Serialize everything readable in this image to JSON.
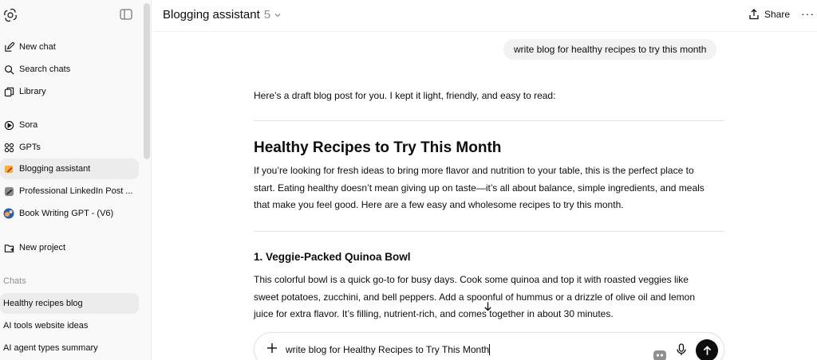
{
  "sidebar": {
    "nav": [
      {
        "label": "New chat",
        "icon": "new-chat-icon"
      },
      {
        "label": "Search chats",
        "icon": "search-icon"
      },
      {
        "label": "Library",
        "icon": "library-icon"
      }
    ],
    "apps": [
      {
        "label": "Sora",
        "icon": "sora-icon"
      },
      {
        "label": "GPTs",
        "icon": "gpts-icon"
      },
      {
        "label": "Blogging assistant",
        "icon": "blogging-assistant-avatar"
      },
      {
        "label": "Professional LinkedIn Post ...",
        "icon": "linkedin-gpt-avatar"
      },
      {
        "label": "Book Writing GPT - (V6)",
        "icon": "book-writing-gpt-avatar"
      }
    ],
    "new_project": "New project",
    "chats_heading": "Chats",
    "chats": [
      "Healthy recipes blog",
      "AI tools website ideas",
      "AI agent types summary"
    ]
  },
  "header": {
    "title": "Blogging assistant",
    "version": "5",
    "share_label": "Share",
    "more_label": "···"
  },
  "conversation": {
    "user_message": "write blog for healthy recipes to try this month",
    "intro": "Here’s a draft blog post for you. I kept it light, friendly, and easy to read:",
    "post_title": "Healthy Recipes to Try This Month",
    "post_intro_lines": [
      "If you’re looking for fresh ideas to bring more flavor and nutrition to your table, this is the perfect place to",
      "start. Eating healthy doesn’t mean giving up on taste—it’s all about balance, simple ingredients, and meals",
      "that make you feel good. Here are a few easy and wholesome recipes to try this month."
    ],
    "section1_title": "1. Veggie-Packed Quinoa Bowl",
    "section1_lines": [
      "This colorful bowl is a quick go-to for busy days. Cook some quinoa and top it with roasted veggies like",
      "sweet potatoes, zucchini, and bell peppers. Add a spoonful of hummus or a drizzle of olive oil and lemon",
      "juice for extra flavor. It’s filling, nutrient-rich, and comes together in about 30 minutes."
    ]
  },
  "composer": {
    "text": "write blog for Healthy Recipes to Try This Month"
  },
  "colors": {
    "sidebar_bg": "#f9f9f9",
    "active_item_bg": "#ececec",
    "bubble_bg": "#f2f2f2",
    "send_button": "#0d0d0d",
    "muted_text": "#8f8f8f"
  }
}
